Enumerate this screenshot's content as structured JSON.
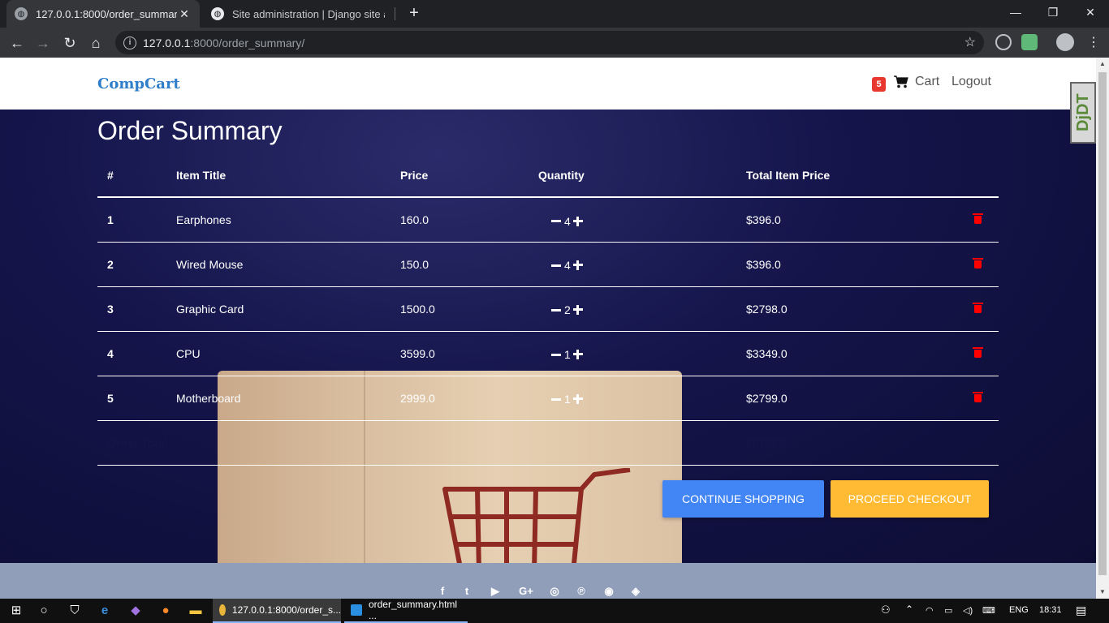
{
  "browser": {
    "tabs": [
      {
        "title": "127.0.0.1:8000/order_summary/",
        "active": true
      },
      {
        "title": "Site administration | Django site admin",
        "active": false
      }
    ],
    "url_host": "127.0.0.1",
    "url_path": ":8000/order_summary/"
  },
  "navbar": {
    "brand": "CompCart",
    "cart_count": "5",
    "cart_label": "Cart",
    "logout_label": "Logout",
    "djdt_label": "DjDT"
  },
  "page": {
    "title": "Order Summary",
    "table": {
      "headers": [
        "#",
        "Item Title",
        "Price",
        "Quantity",
        "Total Item Price"
      ],
      "rows": [
        {
          "num": "1",
          "title": "Earphones",
          "price": "160.0",
          "qty": "4",
          "total": "$396.0"
        },
        {
          "num": "2",
          "title": "Wired Mouse",
          "price": "150.0",
          "qty": "4",
          "total": "$396.0"
        },
        {
          "num": "3",
          "title": "Graphic Card",
          "price": "1500.0",
          "qty": "2",
          "total": "$2798.0"
        },
        {
          "num": "4",
          "title": "CPU",
          "price": "3599.0",
          "qty": "1",
          "total": "$3349.0"
        },
        {
          "num": "5",
          "title": "Motherboard",
          "price": "2999.0",
          "qty": "1",
          "total": "$2799.0"
        }
      ],
      "order_total_label": "Order Total",
      "order_total_value": "$9738.0"
    },
    "buttons": {
      "continue": "CONTINUE SHOPPING",
      "checkout": "PROCEED CHECKOUT"
    }
  },
  "footer": {
    "social_icons": [
      "facebook-icon",
      "twitter-icon",
      "youtube-icon",
      "google-plus-icon",
      "dribbble-icon",
      "pinterest-icon",
      "github-icon",
      "codepen-icon"
    ],
    "glyphs": [
      "f",
      "t",
      "▶",
      "G+",
      "◎",
      "℗",
      "◉",
      "◈"
    ]
  },
  "taskbar": {
    "items": [
      {
        "label": "127.0.0.1:8000/order_s..."
      },
      {
        "label": "order_summary.html ..."
      }
    ],
    "lang": "ENG",
    "time": "18:31"
  },
  "colors": {
    "brand": "#2e7ec9",
    "continue_button": "#4285f4",
    "checkout_button": "#ffbb33",
    "delete_icon": "#ff0000",
    "cart_badge": "#e8372f",
    "footer": "#919eb9"
  }
}
